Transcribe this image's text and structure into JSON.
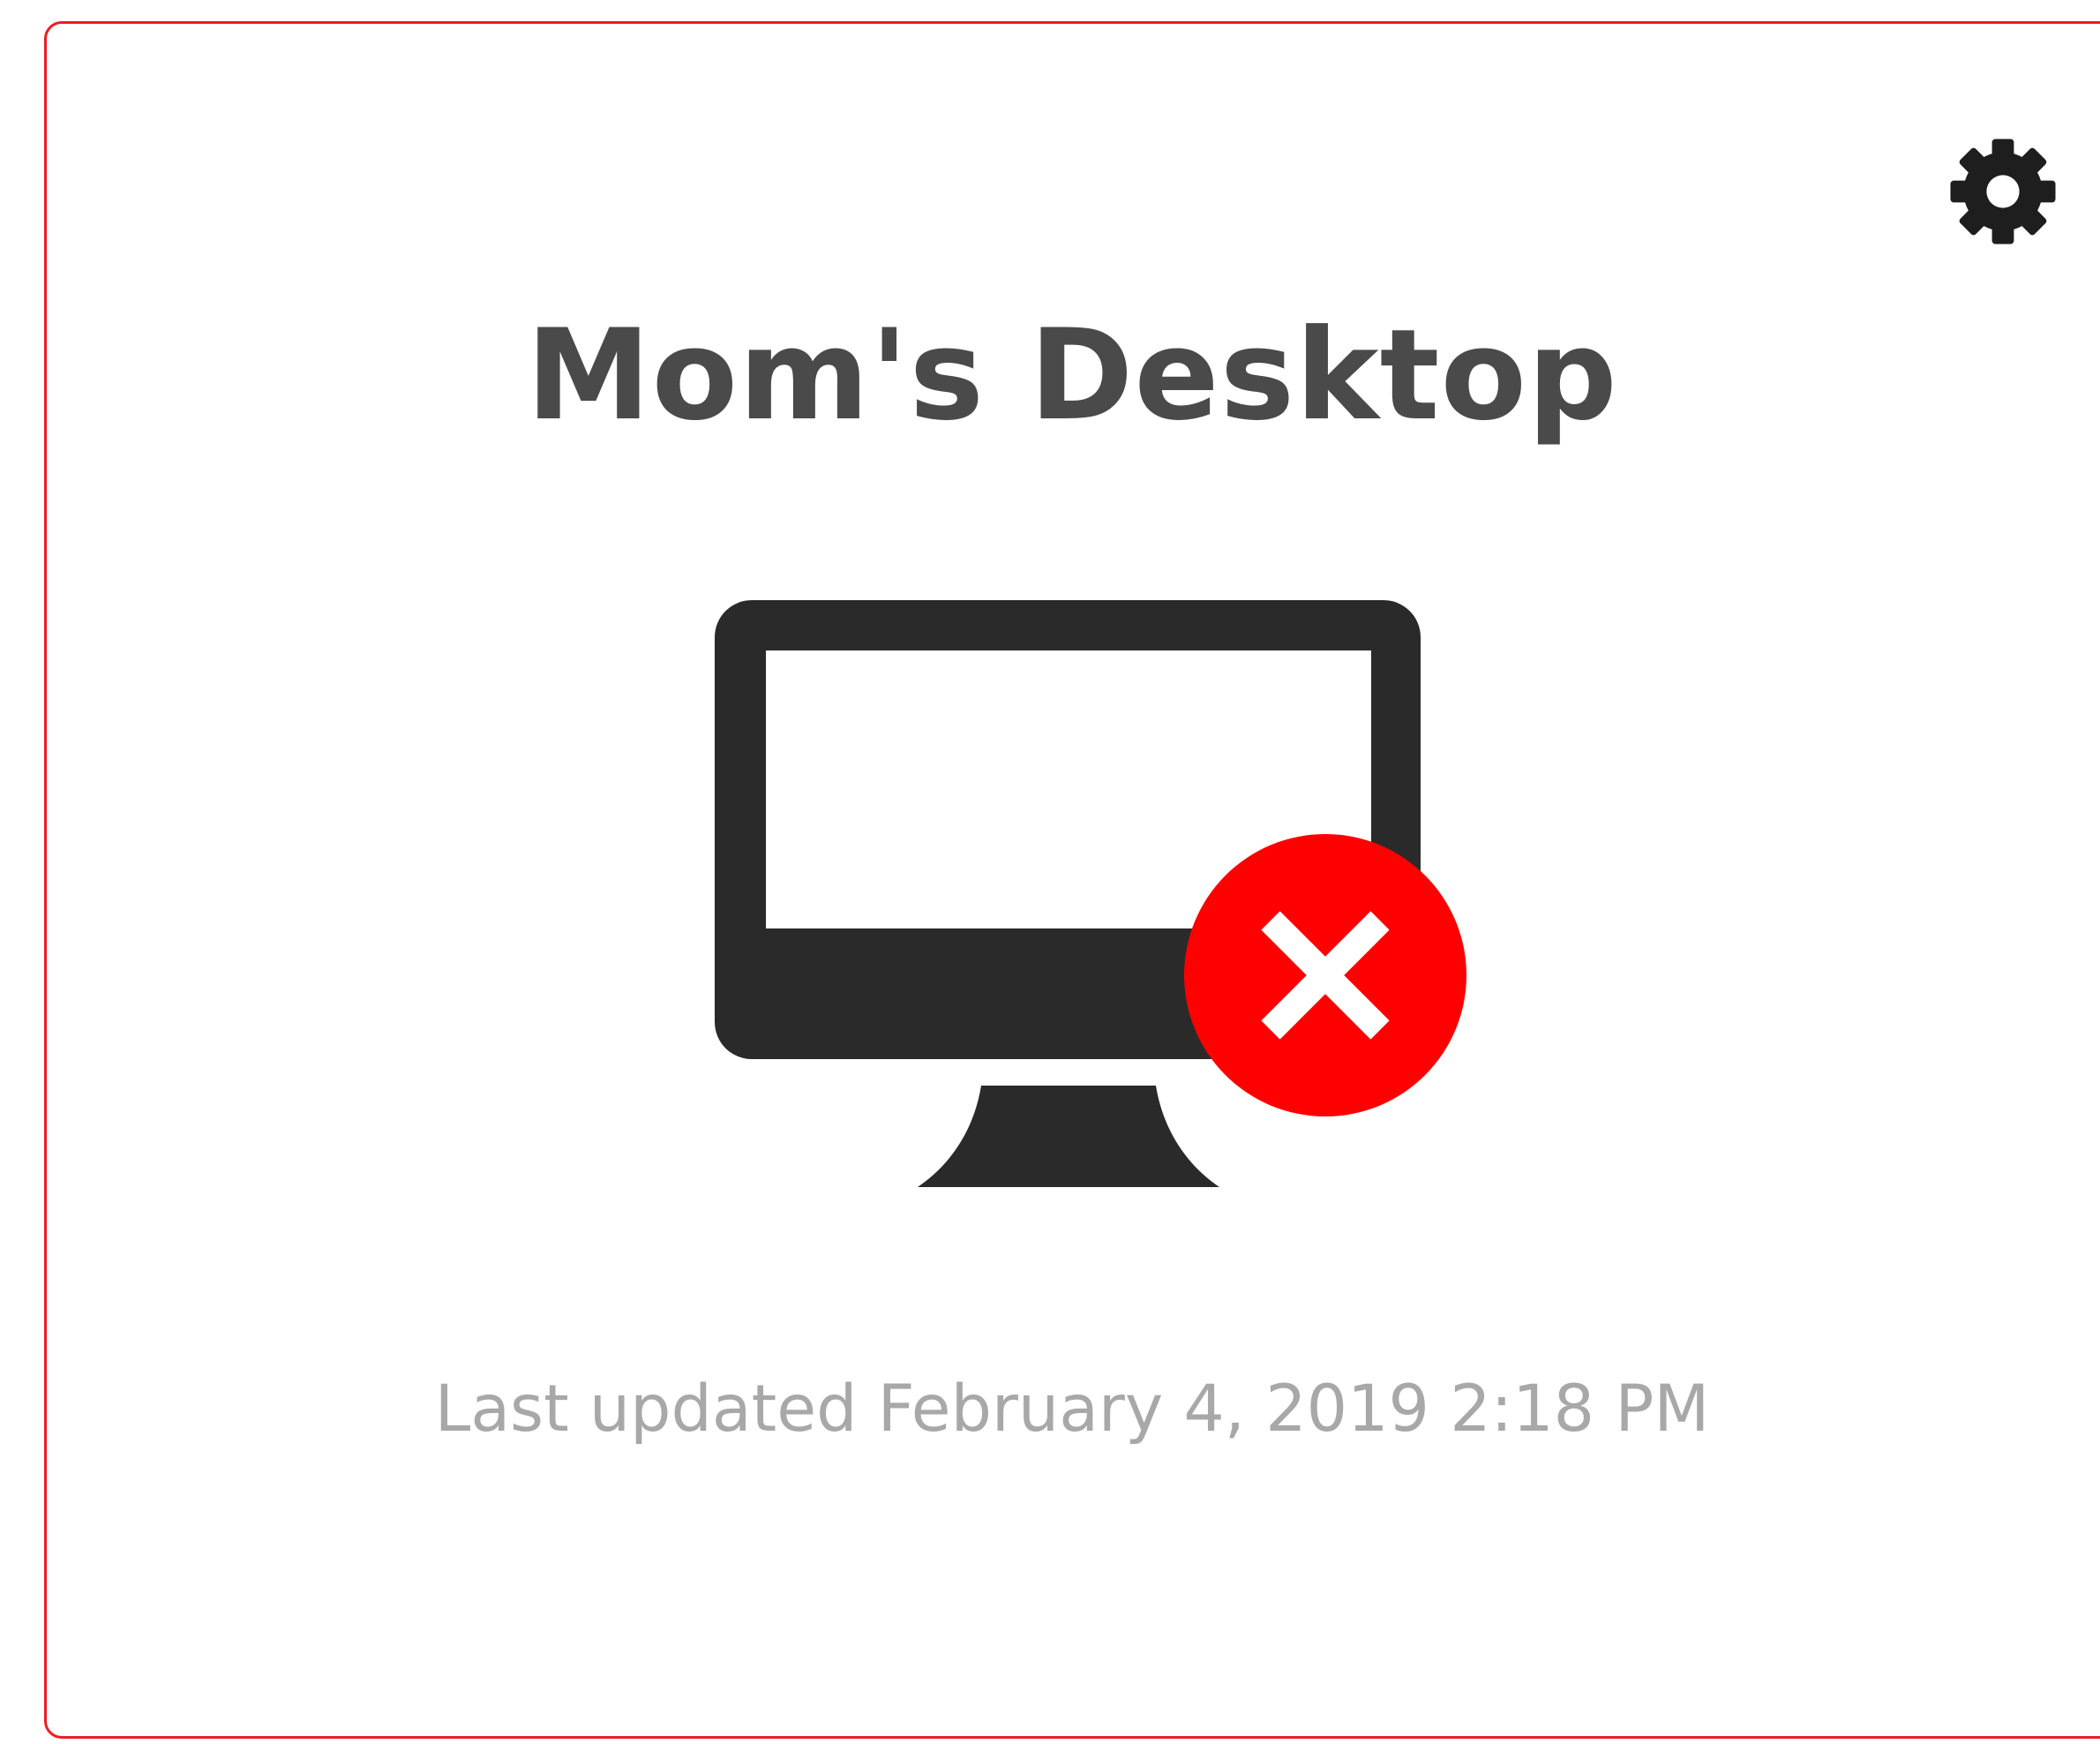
{
  "card": {
    "device_name": "Mom's Desktop",
    "last_updated": "Last updated February 4, 2019 2:18 PM",
    "status": "offline",
    "border_color": "#ee1c25"
  },
  "icons": {
    "settings": "gear-icon",
    "device": "desktop-monitor-icon",
    "status": "error-x-icon"
  },
  "colors": {
    "icon_dark": "#2a2a2a",
    "error_red": "#ff0000",
    "title_text": "#4a4a4a",
    "muted_text": "#a8a8a8"
  }
}
